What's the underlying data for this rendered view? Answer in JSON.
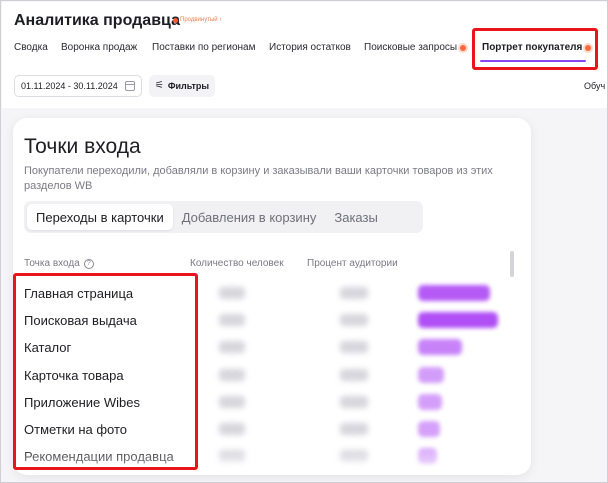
{
  "header": {
    "title": "Аналитика продавца",
    "badge": "Продвинутый"
  },
  "tabs": [
    {
      "label": "Сводка",
      "dot": false,
      "active": false
    },
    {
      "label": "Воронка продаж",
      "dot": false,
      "active": false
    },
    {
      "label": "Поставки по регионам",
      "dot": false,
      "active": false
    },
    {
      "label": "История остатков",
      "dot": false,
      "active": false
    },
    {
      "label": "Поисковые запросы",
      "dot": true,
      "active": false
    },
    {
      "label": "Портрет покупателя",
      "dot": true,
      "active": true
    }
  ],
  "toolbar": {
    "date_range": "01.11.2024 - 30.11.2024",
    "filters_label": "Фильтры",
    "cut_label": "Обуч"
  },
  "card": {
    "title": "Точки входа",
    "description": "Покупатели переходили, добавляли в корзину и заказывали ваши карточки товаров из этих разделов WB",
    "segments": [
      {
        "label": "Переходы в карточки",
        "active": true
      },
      {
        "label": "Добавления в корзину",
        "active": false
      },
      {
        "label": "Заказы",
        "active": false
      }
    ],
    "columns": {
      "entry": "Точка входа",
      "count": "Количество человек",
      "percent": "Процент аудитории"
    },
    "rows": [
      {
        "label": "Главная страница",
        "bar_fraction": 0.9
      },
      {
        "label": "Поисковая выдача",
        "bar_fraction": 1.0
      },
      {
        "label": "Каталог",
        "bar_fraction": 0.55
      },
      {
        "label": "Карточка товара",
        "bar_fraction": 0.32
      },
      {
        "label": "Приложение Wibes",
        "bar_fraction": 0.3
      },
      {
        "label": "Отметки на фото",
        "bar_fraction": 0.28
      },
      {
        "label": "Рекомендации продавца",
        "bar_fraction": 0.24
      }
    ]
  },
  "colors": {
    "accent": "#8a46f0",
    "highlight": "#e8151c",
    "bar": "#b04ff5",
    "notification": "#ff6a3d"
  }
}
